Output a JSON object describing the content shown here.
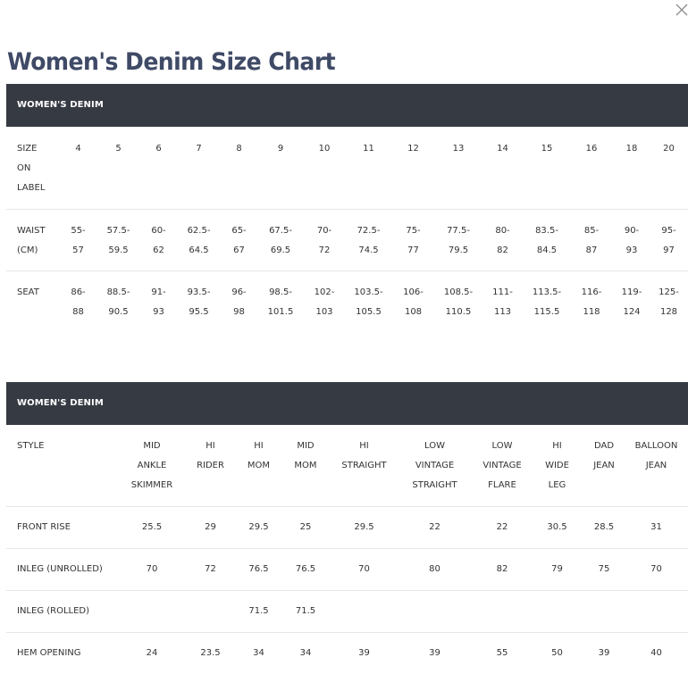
{
  "page": {
    "title": "Women's Denim Size Chart",
    "close_icon": "close-icon"
  },
  "table1": {
    "band": "WOMEN'S DENIM",
    "rows": [
      {
        "label": "SIZE\nON\nLABEL",
        "cells": [
          "4",
          "5",
          "6",
          "7",
          "8",
          "9",
          "10",
          "11",
          "12",
          "13",
          "14",
          "15",
          "16",
          "18",
          "20"
        ]
      },
      {
        "label": "WAIST\n(CM)",
        "cells": [
          "55-\n57",
          "57.5-\n59.5",
          "60-\n62",
          "62.5-\n64.5",
          "65-\n67",
          "67.5-\n69.5",
          "70-\n72",
          "72.5-\n74.5",
          "75-\n77",
          "77.5-\n79.5",
          "80-\n82",
          "83.5-\n84.5",
          "85-\n87",
          "90-\n93",
          "95-\n97"
        ]
      },
      {
        "label": "SEAT",
        "cells": [
          "86-\n88",
          "88.5-\n90.5",
          "91-\n93",
          "93.5-\n95.5",
          "96-\n98",
          "98.5-\n101.5",
          "102-\n103",
          "103.5-\n105.5",
          "106-\n108",
          "108.5-\n110.5",
          "111-\n113",
          "113.5-\n115.5",
          "116-\n118",
          "119-\n124",
          "125-\n128"
        ]
      }
    ]
  },
  "table2": {
    "band": "WOMEN'S DENIM",
    "rows": [
      {
        "label": "STYLE",
        "cells": [
          "MID\nANKLE\nSKIMMER",
          "HI\nRIDER",
          "HI\nMOM",
          "MID\nMOM",
          "HI\nSTRAIGHT",
          "LOW\nVINTAGE\nSTRAIGHT",
          "LOW\nVINTAGE\nFLARE",
          "HI\nWIDE\nLEG",
          "DAD\nJEAN",
          "BALLOON\nJEAN"
        ]
      },
      {
        "label": "FRONT RISE",
        "cells": [
          "25.5",
          "29",
          "29.5",
          "25",
          "29.5",
          "22",
          "22",
          "30.5",
          "28.5",
          "31"
        ]
      },
      {
        "label": "INLEG (UNROLLED)",
        "cells": [
          "70",
          "72",
          "76.5",
          "76.5",
          "70",
          "80",
          "82",
          "79",
          "75",
          "70"
        ]
      },
      {
        "label": "INLEG (ROLLED)",
        "cells": [
          "",
          "",
          "71.5",
          "71.5",
          "",
          "",
          "",
          "",
          "",
          ""
        ]
      },
      {
        "label": "HEM OPENING",
        "cells": [
          "24",
          "23.5",
          "34",
          "34",
          "39",
          "39",
          "55",
          "50",
          "39",
          "40"
        ]
      }
    ]
  }
}
